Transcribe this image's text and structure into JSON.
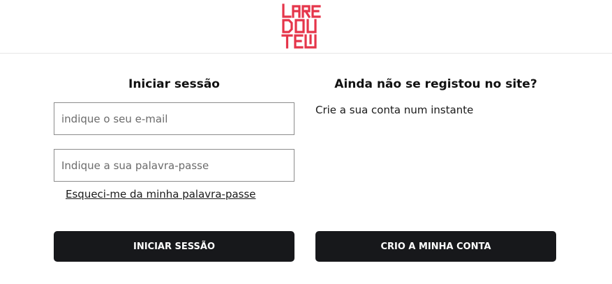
{
  "brand": {
    "logo_text": "LAREDOUTE",
    "logo_color": "#e5354a"
  },
  "login": {
    "title": "Iniciar sessão",
    "email_placeholder": "indique o seu e-mail",
    "password_placeholder": "Indique a sua palavra-passe",
    "forgot_link": "Esqueci-me da minha palavra-passe",
    "submit_label": "INICIAR SESSÃO"
  },
  "register": {
    "title": "Ainda não se registou no site?",
    "text": "Crie a sua conta num instante",
    "button_label": "CRIO A MINHA CONTA"
  },
  "colors": {
    "button_bg": "#17181b",
    "button_text": "#ffffff",
    "field_border": "#8c8c8c"
  }
}
